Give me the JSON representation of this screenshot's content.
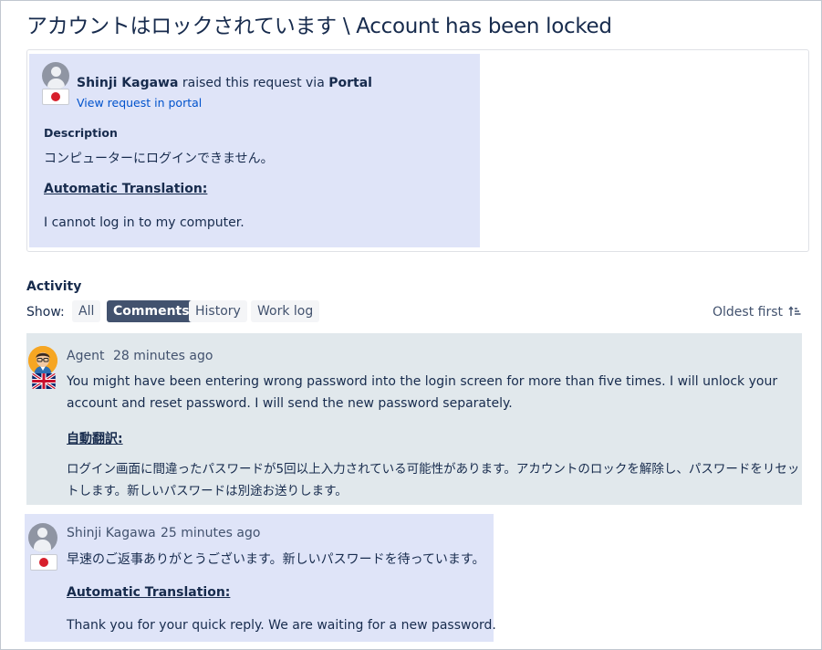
{
  "page_title": "アカウントはロックされています \\ Account has been locked",
  "request": {
    "reporter_name": "Shinji Kagawa",
    "raised_text": " raised this request via ",
    "channel": "Portal",
    "view_link": "View request in portal",
    "description_label": "Description",
    "description_text": "コンピューターにログインできません。",
    "translation_label": "Automatic Translation:",
    "translation_text": "I cannot log in to my computer."
  },
  "activity": {
    "heading": "Activity",
    "show_label": "Show:",
    "filters": [
      "All",
      "Comments",
      "History",
      "Work log"
    ],
    "active_filter": "Comments",
    "sort_label": "Oldest first",
    "sort_icon": "sort-ascending-icon"
  },
  "comments": [
    {
      "author": "Agent",
      "time": "28 minutes ago",
      "flag": "uk-flag-icon",
      "body": "You might have been entering wrong password into the login screen for more than five times. I will unlock your account and reset password. I will send the new password separately.",
      "translation_label": "自動翻訳:",
      "translation_text": "ログイン画面に間違ったパスワードが5回以上入力されている可能性があります。アカウントのロックを解除し、パスワードをリセットします。新しいパスワードは別途お送りします。"
    },
    {
      "author": "Shinji Kagawa",
      "time": "25 minutes ago",
      "flag": "japan-flag-icon",
      "body": "早速のご返事ありがとうございます。新しいパスワードを待っています。",
      "translation_label": "Automatic Translation:",
      "translation_text": "Thank you for your quick reply. We are waiting for a new password."
    }
  ],
  "colors": {
    "text": "#172b4d",
    "link": "#0052cc",
    "customer_highlight": "#dfe4f8",
    "agent_highlight": "#e1e8ec",
    "active_filter_bg": "#42526e",
    "japan_red": "#d71f2c"
  }
}
